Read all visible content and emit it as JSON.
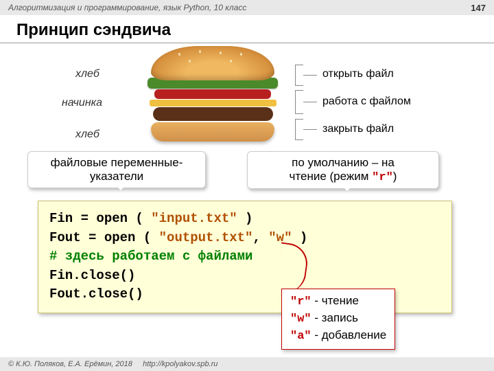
{
  "header": {
    "course": "Алгоритмизация и программирование, язык Python, 10 класс",
    "page": "147"
  },
  "title": "Принцип сэндвича",
  "left": {
    "bread1": "хлеб",
    "filling": "начинка",
    "bread2": "хлеб"
  },
  "right": {
    "open": "открыть файл",
    "work": "работа с  файлом",
    "close": "закрыть файл"
  },
  "callout": {
    "left1": "файловые переменные-",
    "left2": "указатели",
    "right1": "по умолчанию – на",
    "right2a": "чтение (режим ",
    "right2b": "\"r\"",
    "right2c": ")"
  },
  "code": {
    "l1a": "Fin = open ( ",
    "l1b": "\"input.txt\"",
    "l1c": " )",
    "l2a": "Fout = open ( ",
    "l2b": "\"output.txt\"",
    "l2c": ", ",
    "l2d": "\"w\"",
    "l2e": " )",
    "l3": "  # здесь работаем с файлами",
    "l4": "Fin.close()",
    "l5": "Fout.close()"
  },
  "modes": {
    "r": "\"r\"",
    "rt": " - чтение",
    "w": "\"w\"",
    "wt": " - запись",
    "a": "\"a\"",
    "at": " - добавление"
  },
  "footer": {
    "copy": "© К.Ю. Поляков, Е.А. Ерёмин, 2018",
    "url": "http://kpolyakov.spb.ru"
  }
}
